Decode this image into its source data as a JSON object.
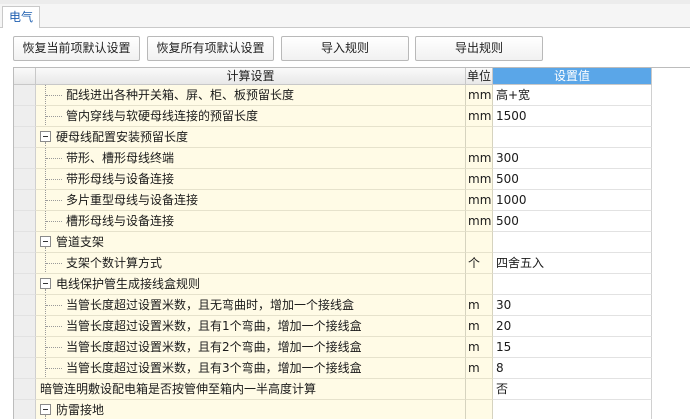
{
  "window": {
    "tab": "电气"
  },
  "toolbar": {
    "restore_current": "恢复当前项默认设置",
    "restore_all": "恢复所有项默认设置",
    "import_rules": "导入规则",
    "export_rules": "导出规则"
  },
  "table": {
    "headers": {
      "setting": "计算设置",
      "unit": "单位",
      "value": "设置值"
    },
    "rows": [
      {
        "kind": "child",
        "label": "配线进出各种开关箱、屏、柜、板预留长度",
        "unit": "mm",
        "value": "高+宽"
      },
      {
        "kind": "child",
        "label": "管内穿线与软硬母线连接的预留长度",
        "unit": "mm",
        "value": "1500"
      },
      {
        "kind": "group",
        "label": "硬母线配置安装预留长度",
        "unit": "",
        "value": ""
      },
      {
        "kind": "child",
        "label": "带形、槽形母线终端",
        "unit": "mm",
        "value": "300"
      },
      {
        "kind": "child",
        "label": "带形母线与设备连接",
        "unit": "mm",
        "value": "500"
      },
      {
        "kind": "child",
        "label": "多片重型母线与设备连接",
        "unit": "mm",
        "value": "1000"
      },
      {
        "kind": "child",
        "label": "槽形母线与设备连接",
        "unit": "mm",
        "value": "500"
      },
      {
        "kind": "group",
        "label": "管道支架",
        "unit": "",
        "value": ""
      },
      {
        "kind": "child",
        "label": "支架个数计算方式",
        "unit": "个",
        "value": "四舍五入"
      },
      {
        "kind": "group",
        "label": "电线保护管生成接线盒规则",
        "unit": "",
        "value": ""
      },
      {
        "kind": "child",
        "label": "当管长度超过设置米数，且无弯曲时，增加一个接线盒",
        "unit": "m",
        "value": "30"
      },
      {
        "kind": "child",
        "label": "当管长度超过设置米数，且有1个弯曲，增加一个接线盒",
        "unit": "m",
        "value": "20"
      },
      {
        "kind": "child",
        "label": "当管长度超过设置米数，且有2个弯曲，增加一个接线盒",
        "unit": "m",
        "value": "15"
      },
      {
        "kind": "child",
        "label": "当管长度超过设置米数，且有3个弯曲，增加一个接线盒",
        "unit": "m",
        "value": "8"
      },
      {
        "kind": "root",
        "label": "暗管连明敷设配电箱是否按管伸至箱内一半高度计算",
        "unit": "",
        "value": "否"
      },
      {
        "kind": "group",
        "label": "防雷接地",
        "unit": "",
        "value": ""
      }
    ]
  }
}
